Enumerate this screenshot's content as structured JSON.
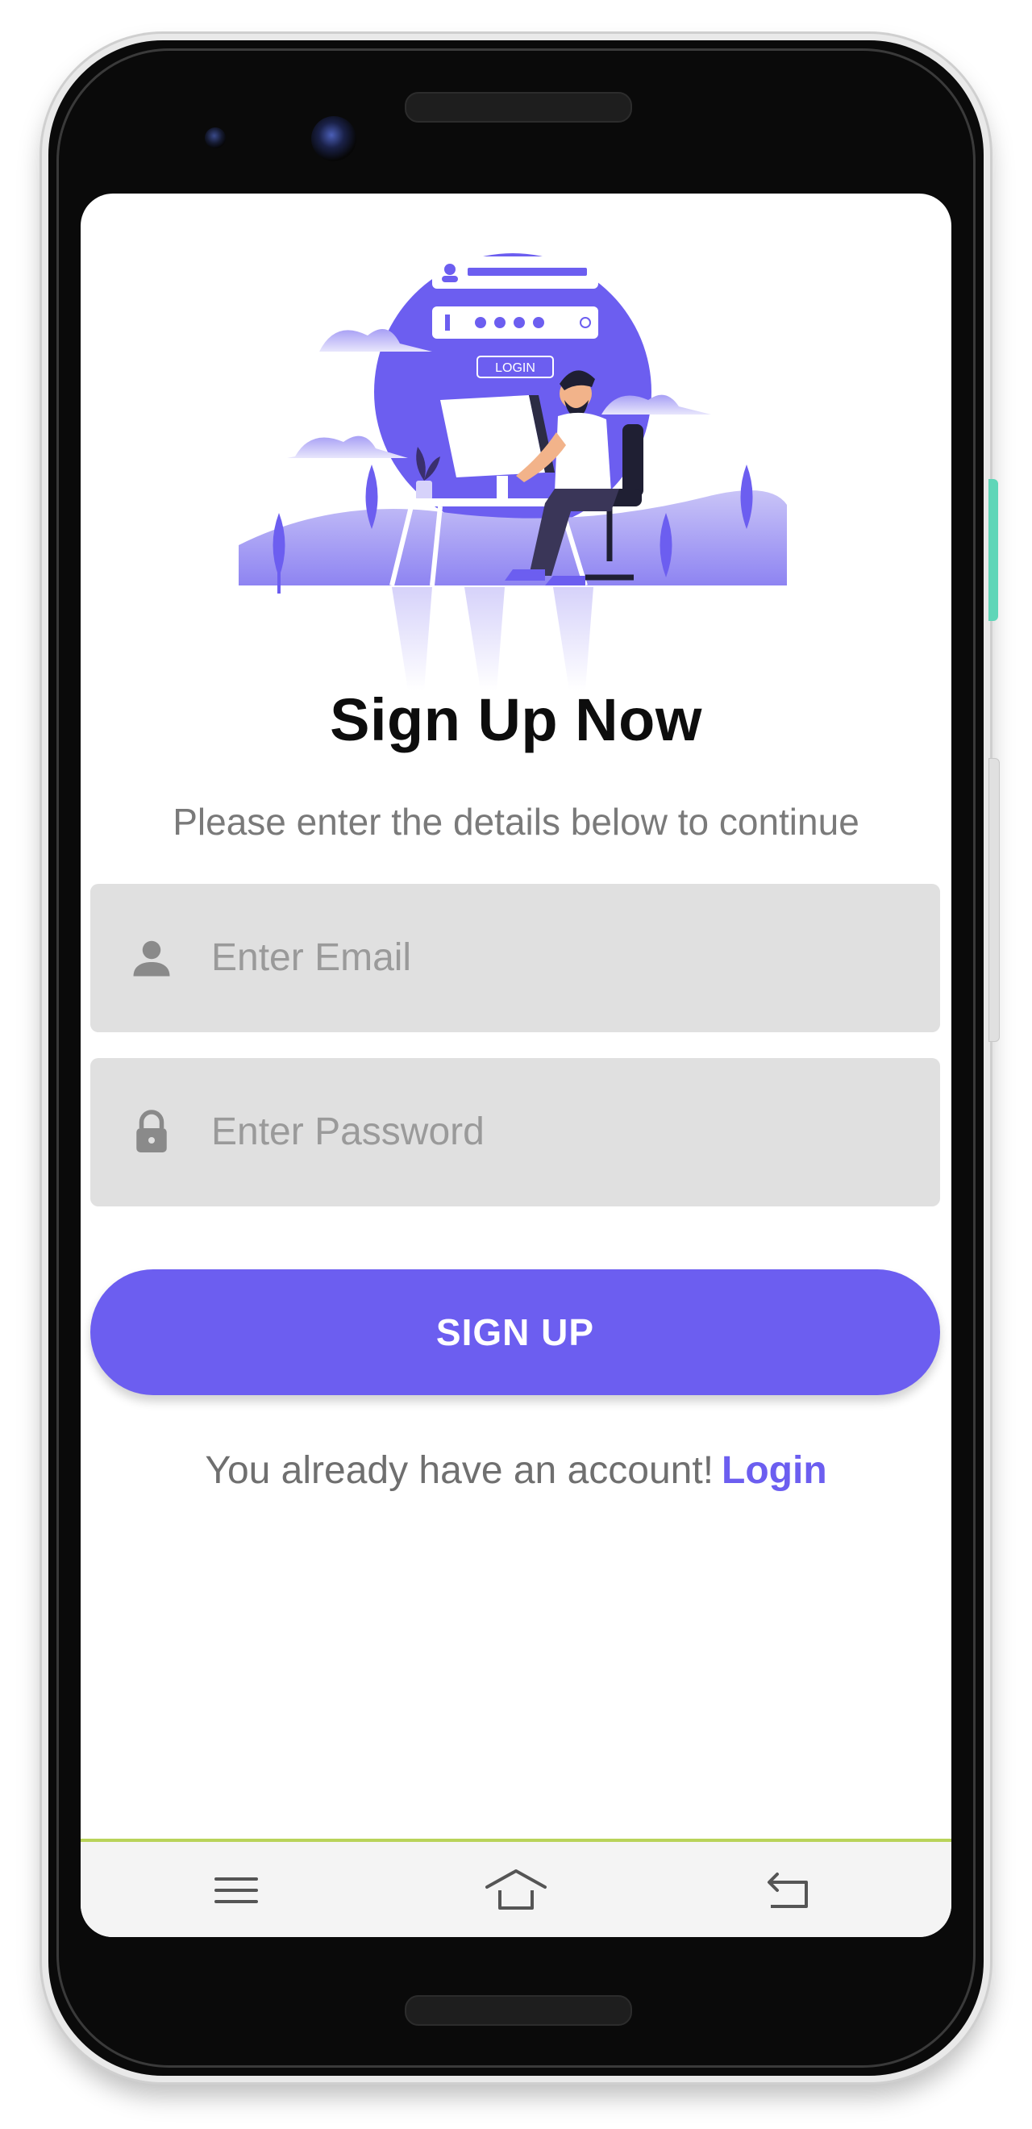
{
  "screen": {
    "title": "Sign Up Now",
    "subtitle": "Please enter the details below to continue"
  },
  "illustration": {
    "login_label": "LOGIN"
  },
  "form": {
    "email": {
      "placeholder": "Enter Email",
      "icon": "person-icon"
    },
    "password": {
      "placeholder": "Enter Password",
      "icon": "lock-icon"
    },
    "submit_label": "SIGN UP"
  },
  "footer": {
    "prompt": "You already have an account!",
    "link": "Login"
  },
  "nav": {
    "items": [
      {
        "icon": "menu-icon"
      },
      {
        "icon": "home-icon"
      },
      {
        "icon": "back-icon"
      }
    ]
  },
  "colors": {
    "accent": "#6c5ef0",
    "field_bg": "#e0e0e0",
    "nav_line": "#b9d35a",
    "side_button": "#5fd6b8"
  }
}
